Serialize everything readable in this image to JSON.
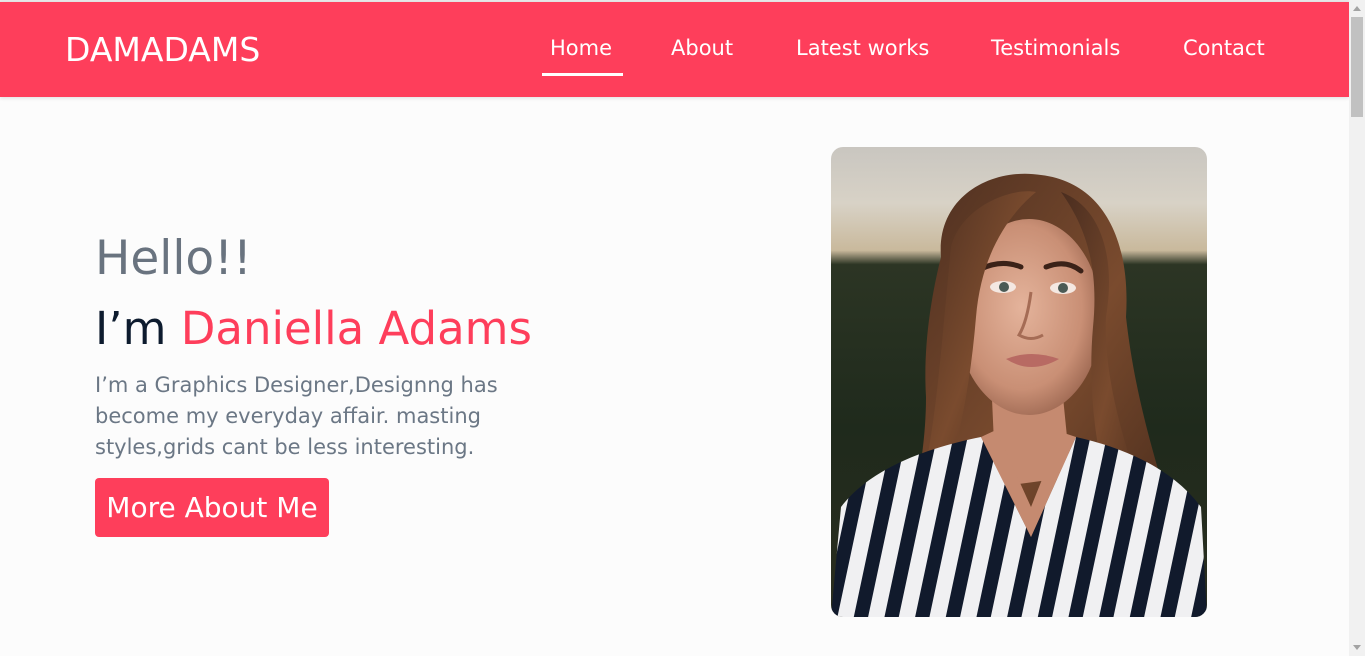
{
  "header": {
    "brand": "DAMADAMS",
    "nav": [
      {
        "label": "Home",
        "active": true
      },
      {
        "label": "About",
        "active": false
      },
      {
        "label": "Latest works",
        "active": false
      },
      {
        "label": "Testimonials",
        "active": false
      },
      {
        "label": "Contact",
        "active": false
      }
    ]
  },
  "hero": {
    "greeting": "Hello!!",
    "im": "I’m ",
    "name": "Daniella Adams",
    "description": "I’m a Graphics Designer,Designng has become my everyday affair. masting styles,grids cant be less interesting.",
    "button_label": "More About Me",
    "portrait_icon": "portrait-photo"
  },
  "colors": {
    "accent": "#fe3e5b",
    "heading_dark": "#0d1b2e",
    "muted_text": "#69737f",
    "background": "#fcfcfc"
  }
}
